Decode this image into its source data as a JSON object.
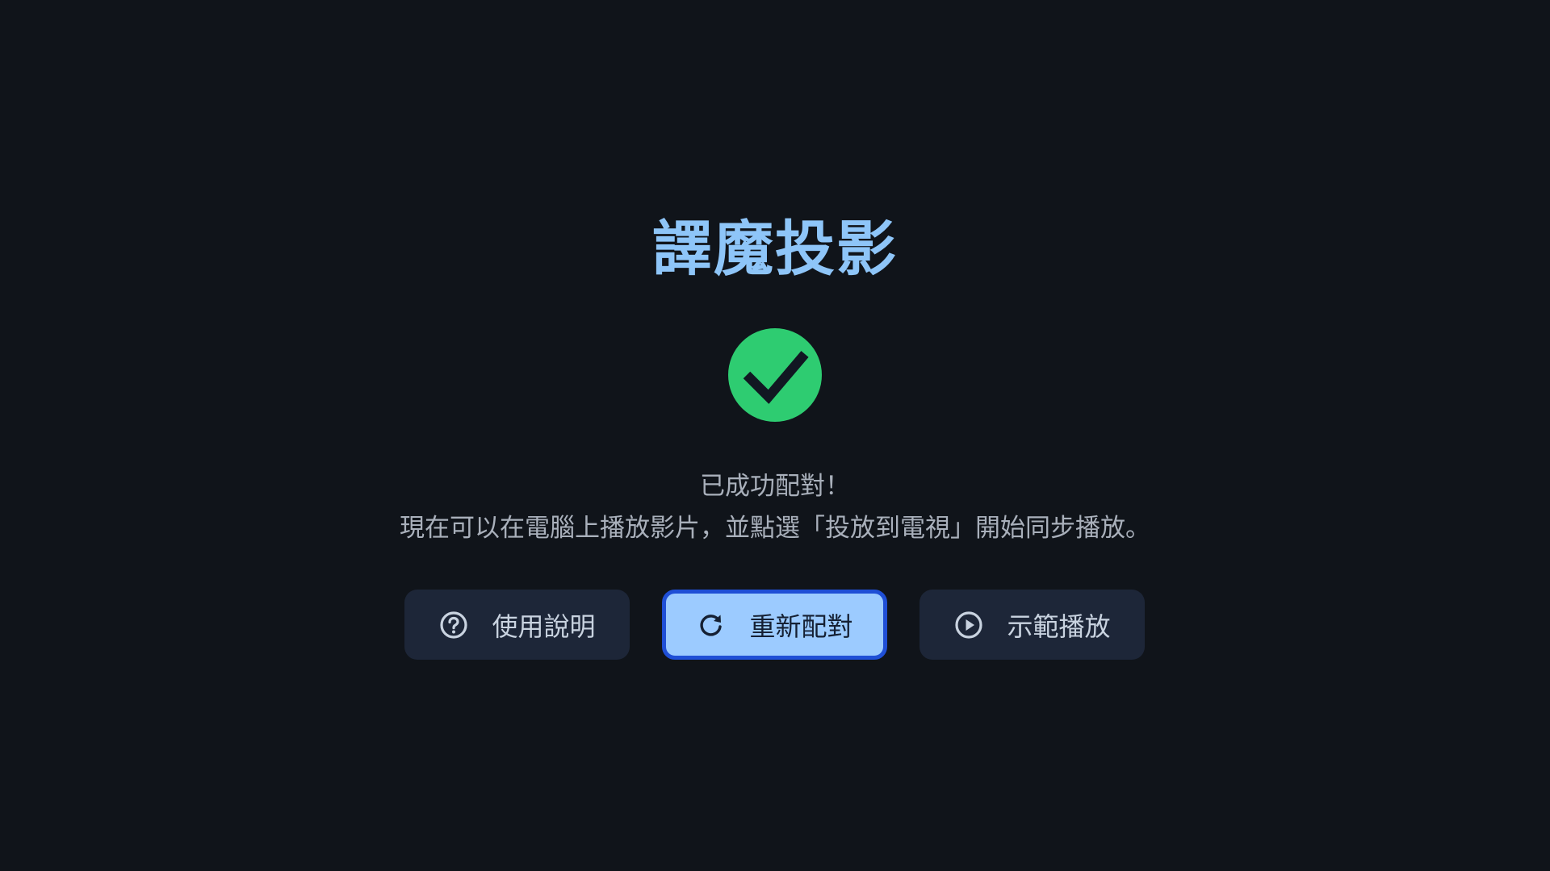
{
  "app": {
    "title": "譯魔投影"
  },
  "status": {
    "icon": "check-circle-icon",
    "line1": "已成功配對！",
    "line2": "現在可以在電腦上播放影片，並點選「投放到電視」開始同步播放。"
  },
  "actions": [
    {
      "label": "使用說明",
      "icon": "help-circle-icon",
      "focused": false
    },
    {
      "label": "重新配對",
      "icon": "refresh-icon",
      "focused": true
    },
    {
      "label": "示範播放",
      "icon": "play-circle-icon",
      "focused": false
    }
  ],
  "colors": {
    "background": "#10141a",
    "title": "#8ec5f8",
    "success": "#2ecc71",
    "button": "#1d2638",
    "button_focused": "#9ccbff",
    "focus_ring": "#1f4fd6"
  }
}
